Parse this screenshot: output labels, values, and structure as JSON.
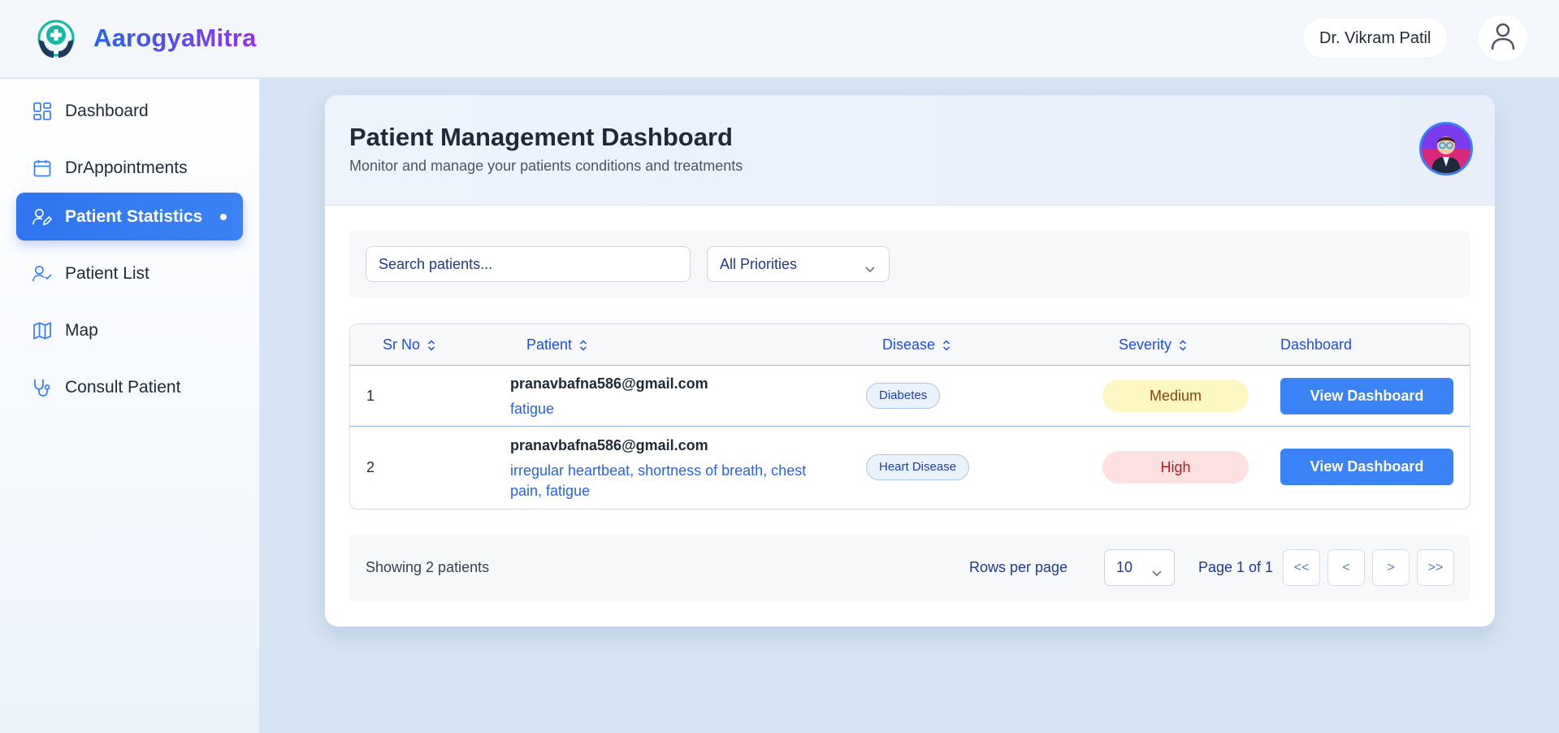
{
  "app": {
    "brand": "AarogyaMitra",
    "user_name": "Dr. Vikram Patil"
  },
  "sidebar": {
    "items": [
      {
        "label": "Dashboard",
        "icon": "dashboard-icon",
        "active": false
      },
      {
        "label": "DrAppointments",
        "icon": "calendar-icon",
        "active": false
      },
      {
        "label": "Patient Statistics",
        "icon": "user-edit-icon",
        "active": true
      },
      {
        "label": "Patient List",
        "icon": "user-check-icon",
        "active": false
      },
      {
        "label": "Map",
        "icon": "map-icon",
        "active": false
      },
      {
        "label": "Consult Patient",
        "icon": "stethoscope-icon",
        "active": false
      }
    ]
  },
  "main": {
    "title": "Patient Management Dashboard",
    "subtitle": "Monitor and manage your patients conditions and treatments",
    "search": {
      "placeholder": "Search patients...",
      "value": ""
    },
    "priority_filter": {
      "selected": "All Priorities"
    },
    "table": {
      "columns": [
        "Sr No",
        "Patient",
        "Disease",
        "Severity",
        "Dashboard"
      ],
      "rows": [
        {
          "sr": "1",
          "email": "pranavbafna586@gmail.com",
          "symptoms": "fatigue",
          "disease": "Diabetes",
          "severity": "Medium",
          "action": "View Dashboard"
        },
        {
          "sr": "2",
          "email": "pranavbafna586@gmail.com",
          "symptoms": "irregular heartbeat, shortness of breath, chest pain, fatigue",
          "disease": "Heart Disease",
          "severity": "High",
          "action": "View Dashboard"
        }
      ]
    },
    "footer": {
      "showing": "Showing 2 patients",
      "rows_per_page_label": "Rows per page",
      "rows_per_page": "10",
      "page_info": "Page 1 of 1",
      "first": "<<",
      "prev": "<",
      "next": ">",
      "last": ">>"
    }
  },
  "colors": {
    "accent": "#3b82f6",
    "severity_medium_bg": "#fef6c3",
    "severity_high_bg": "#fde1e1"
  }
}
